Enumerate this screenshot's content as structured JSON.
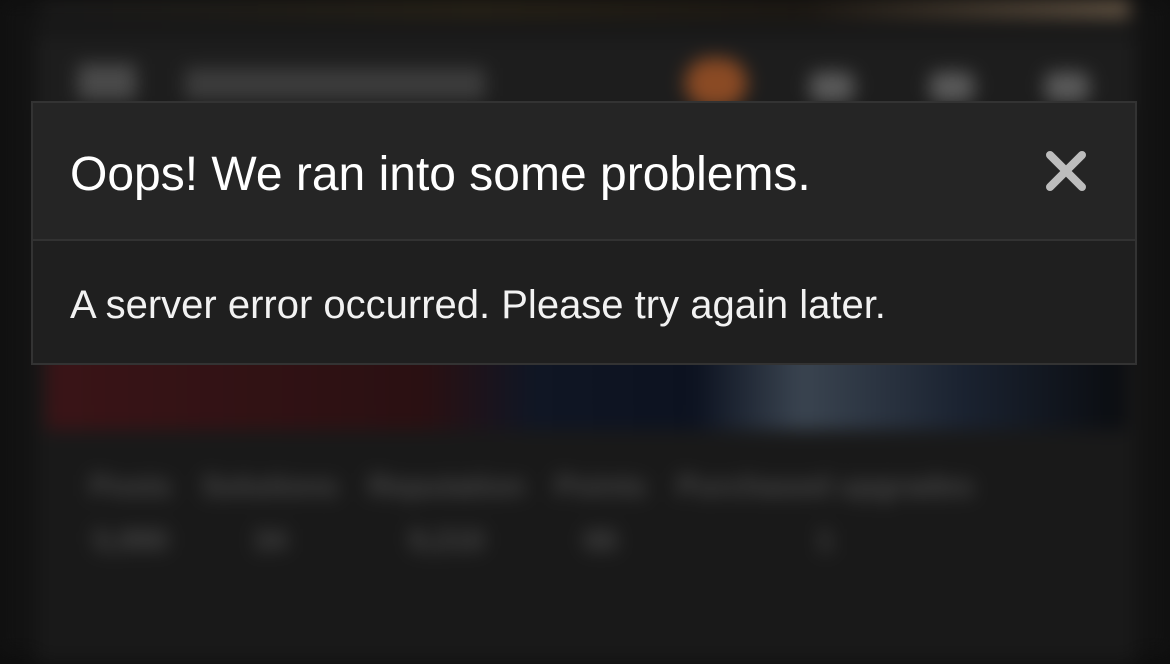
{
  "background": {
    "profile_title": "Lookamore...",
    "stats": [
      {
        "label": "Posts",
        "value": "5,990"
      },
      {
        "label": "Solutions",
        "value": "34"
      },
      {
        "label": "Reputation",
        "value": "9,210"
      },
      {
        "label": "Points",
        "value": "66"
      },
      {
        "label": "Purchased upgrades",
        "value": "1"
      }
    ],
    "header_icons": [
      "menu-icon",
      "chat-icon",
      "bell-icon",
      "search-icon"
    ]
  },
  "dialog": {
    "title": "Oops! We ran into some problems.",
    "message": "A server error occurred. Please try again later.",
    "close_icon": "close-icon",
    "colors": {
      "background": "#1f1f1f",
      "header": "#252525",
      "text": "#ffffff",
      "close": "#bdbdbd"
    }
  }
}
